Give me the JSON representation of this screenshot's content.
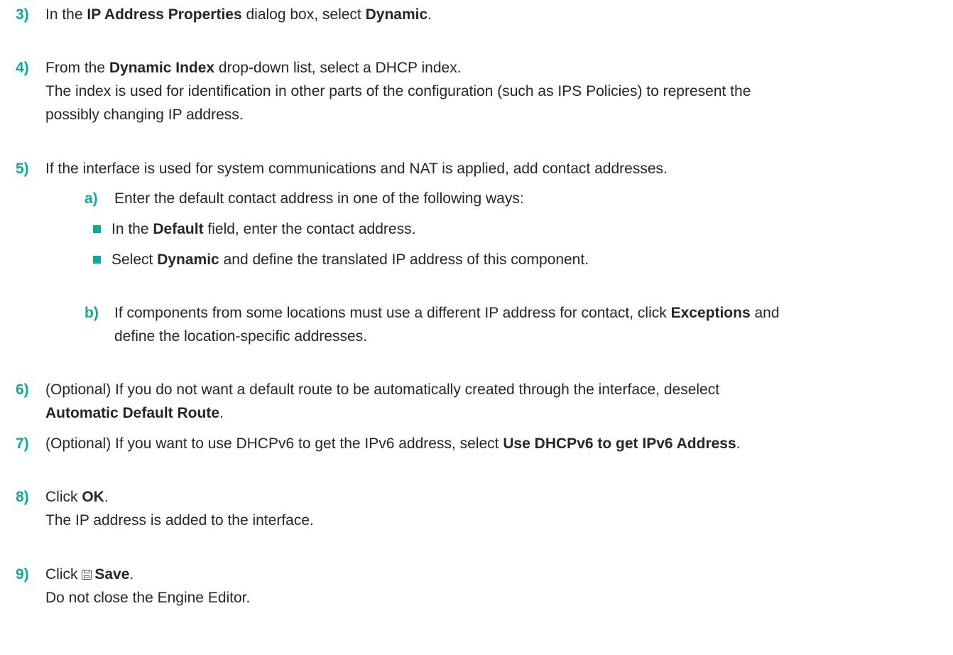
{
  "steps": {
    "s3": {
      "number": "3)",
      "t1": "In the ",
      "b1": "IP Address Properties",
      "t2": " dialog box, select ",
      "b2": "Dynamic",
      "t3": "."
    },
    "s4": {
      "number": "4)",
      "t1": "From the ",
      "b1": "Dynamic Index",
      "t2": " drop-down list, select a DHCP index.",
      "desc_line1": "The index is used for identification in other parts of the configuration (such as IPS Policies) to represent the",
      "desc_line2": "possibly changing IP address."
    },
    "s5": {
      "number": "5)",
      "text": "If the interface is used for system communications and NAT is applied, add contact addresses.",
      "a": {
        "number": "a)",
        "text": "Enter the default contact address in one of the following ways:",
        "bullet1": {
          "t1": "In the ",
          "b1": "Default",
          "t2": " field, enter the contact address."
        },
        "bullet2": {
          "t1": "Select ",
          "b1": "Dynamic",
          "t2": " and define the translated IP address of this component."
        }
      },
      "b": {
        "number": "b)",
        "line1_t1": "If components from some locations must use a different IP address for contact, click ",
        "line1_b1": "Exceptions",
        "line1_t2": " and",
        "line2": "define the location-specific addresses."
      }
    },
    "s6": {
      "number": "6)",
      "line1": "(Optional) If you do not want a default route to be automatically created through the interface, deselect",
      "line2_b1": "Automatic Default Route",
      "line2_t1": "."
    },
    "s7": {
      "number": "7)",
      "t1": "(Optional) If you want to use DHCPv6 to get the IPv6 address, select ",
      "b1": "Use DHCPv6 to get IPv6 Address",
      "t2": "."
    },
    "s8": {
      "number": "8)",
      "t1": "Click ",
      "b1": "OK",
      "t2": ".",
      "result": "The IP address is added to the interface."
    },
    "s9": {
      "number": "9)",
      "t1": "Click ",
      "b1": "Save",
      "t2": ".",
      "result": "Do not close the Engine Editor."
    }
  },
  "colors": {
    "accent": "#0fa6a0",
    "text": "#262626"
  },
  "icons": {
    "save": "floppy-disk-icon",
    "bullet": "square-bullet-icon"
  }
}
